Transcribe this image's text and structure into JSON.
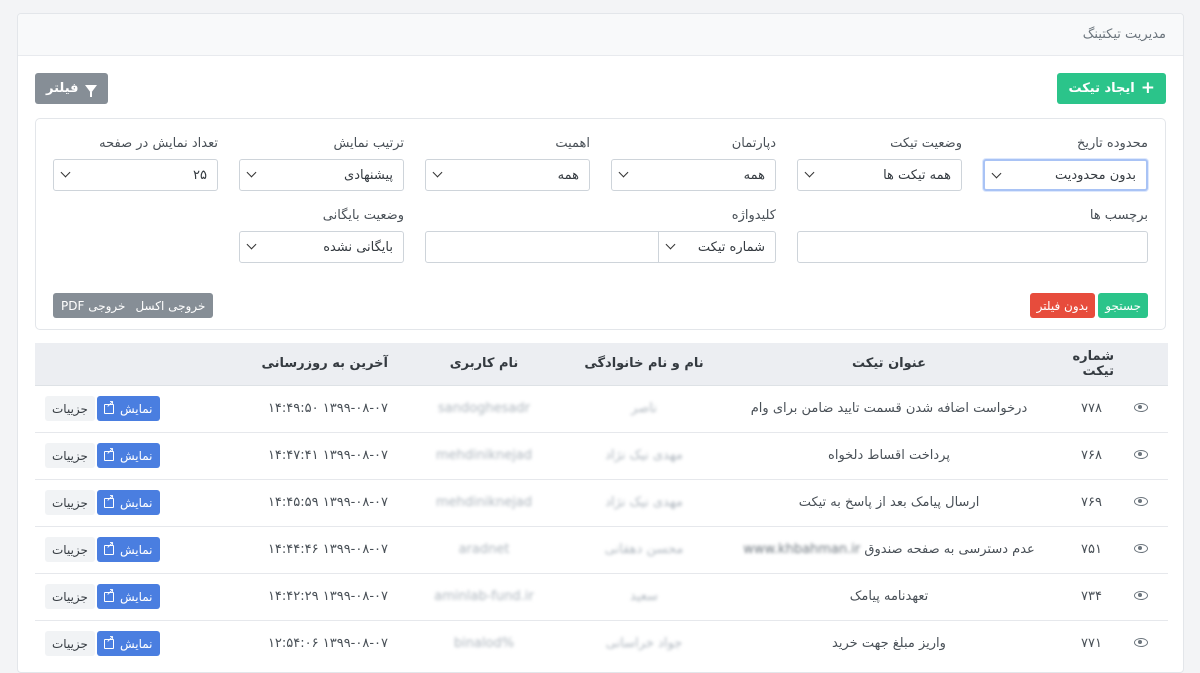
{
  "header": {
    "title": "مدیریت تیکتینگ"
  },
  "toolbar": {
    "create_label": "ایجاد تیکت",
    "create_icon": "plus-icon",
    "filter_label": "فیلتر",
    "filter_icon": "funnel-icon"
  },
  "filters": {
    "date_range": {
      "label": "محدوده تاریخ",
      "value": "بدون محدودیت"
    },
    "status": {
      "label": "وضعیت تیکت",
      "value": "همه تیکت ها"
    },
    "department": {
      "label": "دپارتمان",
      "value": "همه"
    },
    "priority": {
      "label": "اهمیت",
      "value": "همه"
    },
    "sort": {
      "label": "ترتیب نمایش",
      "value": "پیشنهادی"
    },
    "page_size": {
      "label": "تعداد نمایش در صفحه",
      "value": "۲۵"
    },
    "tags": {
      "label": "برچسب ها",
      "value": ""
    },
    "keyword": {
      "label": "کلیدواژه",
      "value": "",
      "type_value": "شماره تیکت"
    },
    "archive": {
      "label": "وضعیت بایگانی",
      "value": "بایگانی نشده"
    },
    "search_label": "جستجو",
    "nofilter_label": "بدون فیلتر",
    "export_excel": "خروجی اکسل",
    "export_pdf": "خروجی PDF"
  },
  "table": {
    "headers": [
      "شماره تیکت",
      "عنوان تیکت",
      "نام و نام خانوادگی",
      "نام کاربری",
      "آخرین به روزرسانی"
    ],
    "show_label": "نمایش",
    "detail_label": "جزییات",
    "rows": [
      {
        "id": "۷۷۸",
        "title": "درخواست اضافه شدن قسمت تایید ضامن برای وام",
        "name": "ناصر",
        "username": "sandoghesadr",
        "updated": "۱۳۹۹-۰۸-۰۷ ۱۴:۴۹:۵۰"
      },
      {
        "id": "۷۶۸",
        "title": "پرداخت اقساط دلخواه",
        "name": "مهدی نیک نژاد",
        "username": "mehdiniknejad",
        "updated": "۱۳۹۹-۰۸-۰۷ ۱۴:۴۷:۴۱"
      },
      {
        "id": "۷۶۹",
        "title": "ارسال پیامک بعد از پاسخ به تیکت",
        "name": "مهدی نیک نژاد",
        "username": "mehdiniknejad",
        "updated": "۱۳۹۹-۰۸-۰۷ ۱۴:۴۵:۵۹"
      },
      {
        "id": "۷۵۱",
        "title": "عدم دسترسی به صفحه صندوق",
        "title_extra": "www.khbahman.ir",
        "name": "محسن دهقانی",
        "username": "aradnet",
        "updated": "۱۳۹۹-۰۸-۰۷ ۱۴:۴۴:۴۶"
      },
      {
        "id": "۷۳۴",
        "title": "تعهدنامه پیامک",
        "name": "سعید",
        "username": "aminlab-fund.ir",
        "updated": "۱۳۹۹-۰۸-۰۷ ۱۴:۴۲:۲۹"
      },
      {
        "id": "۷۷۱",
        "title": "واریز مبلغ جهت خرید",
        "name": "جواد خراسانی",
        "username": "binalod%",
        "updated": "۱۳۹۹-۰۸-۰۷ ۱۲:۵۴:۰۶"
      }
    ]
  }
}
